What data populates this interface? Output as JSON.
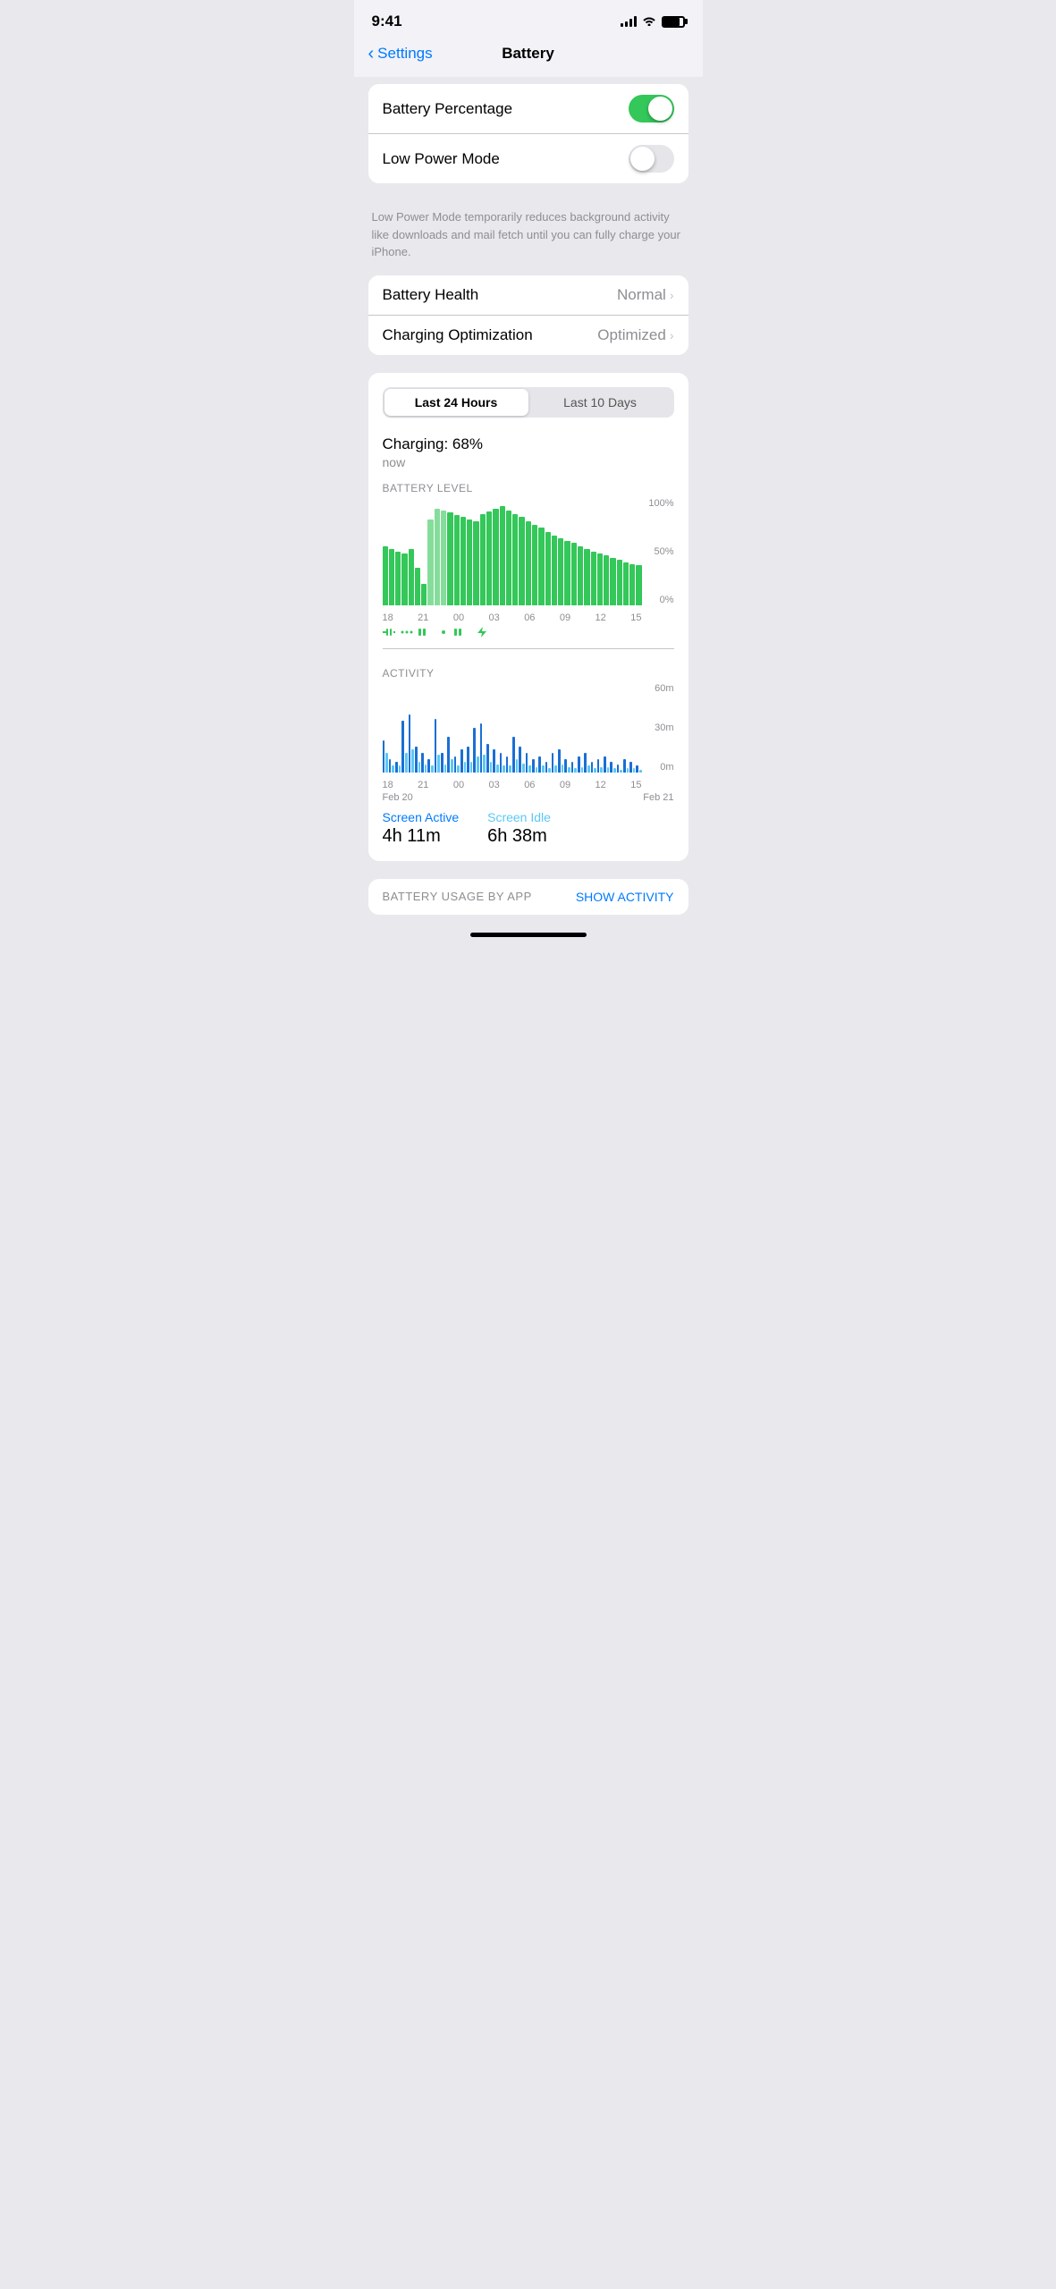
{
  "statusBar": {
    "time": "9:41"
  },
  "nav": {
    "backLabel": "Settings",
    "title": "Battery"
  },
  "toggleSection": {
    "batteryPercentage": {
      "label": "Battery Percentage",
      "enabled": true
    },
    "lowPowerMode": {
      "label": "Low Power Mode",
      "enabled": false
    },
    "hint": "Low Power Mode temporarily reduces background activity like downloads and mail fetch until you can fully charge your iPhone."
  },
  "healthSection": {
    "batteryHealth": {
      "label": "Battery Health",
      "value": "Normal"
    },
    "chargingOptimization": {
      "label": "Charging Optimization",
      "value": "Optimized"
    }
  },
  "chartCard": {
    "segmentLabels": [
      "Last 24 Hours",
      "Last 10 Days"
    ],
    "activeSegment": 0,
    "chargingStatus": "Charging: 68%",
    "chargingTime": "now",
    "batteryLevelLabel": "BATTERY LEVEL",
    "activityLabel": "ACTIVITY",
    "gridLabels": [
      "100%",
      "50%",
      "0%"
    ],
    "actGridLabels": [
      "60m",
      "30m",
      "0m"
    ],
    "xLabels": [
      "18",
      "21",
      "00",
      "03",
      "06",
      "09",
      "12",
      "15"
    ],
    "dateLabels": [
      "Feb 20",
      "Feb 21"
    ],
    "screenActive": {
      "label": "Screen Active",
      "value": "4h 11m"
    },
    "screenIdle": {
      "label": "Screen Idle",
      "value": "6h 38m"
    }
  },
  "bottomSection": {
    "label": "BATTERY USAGE BY APP",
    "action": "SHOW ACTIVITY"
  },
  "batteryBars": [
    55,
    52,
    50,
    48,
    52,
    35,
    20,
    80,
    90,
    88,
    86,
    84,
    82,
    80,
    78,
    85,
    87,
    90,
    92,
    88,
    85,
    82,
    78,
    75,
    72,
    68,
    65,
    62,
    60,
    58,
    55,
    52,
    50,
    48,
    46,
    44,
    42,
    40,
    38,
    37
  ],
  "activityDark": [
    25,
    10,
    8,
    40,
    45,
    20,
    15,
    10,
    42,
    15,
    28,
    12,
    18,
    20,
    35,
    38,
    22,
    18,
    15,
    12,
    28,
    20,
    15,
    10,
    12,
    8,
    15,
    18,
    10,
    8,
    12,
    15,
    8,
    10,
    12,
    8,
    6,
    10,
    8,
    5
  ],
  "activityLight": [
    15,
    5,
    5,
    15,
    18,
    8,
    6,
    5,
    14,
    6,
    10,
    5,
    8,
    8,
    12,
    14,
    8,
    6,
    5,
    5,
    10,
    7,
    5,
    4,
    5,
    3,
    5,
    6,
    4,
    3,
    4,
    5,
    3,
    4,
    4,
    3,
    2,
    3,
    3,
    2
  ]
}
